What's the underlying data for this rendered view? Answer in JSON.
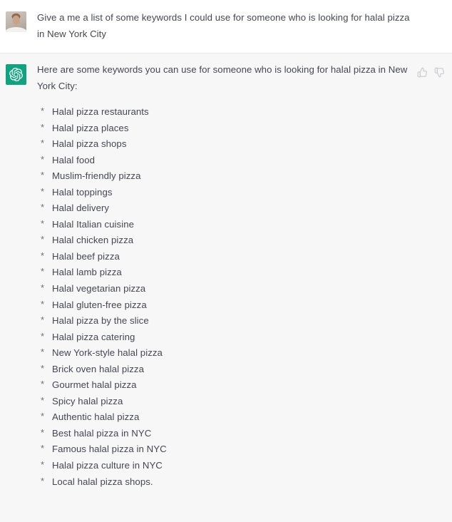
{
  "conversation": {
    "user_turn": {
      "avatar": "user-photo-avatar",
      "message": "Give a me a list of some keywords I could use for someone who is looking for halal pizza in New York City"
    },
    "assistant_turn": {
      "avatar": "openai-logo-avatar",
      "intro": "Here are some keywords you can use for someone who is looking for halal pizza in New York City:",
      "feedback": {
        "thumbs_up": "thumbs-up-icon",
        "thumbs_down": "thumbs-down-icon"
      },
      "bullet_glyph": "*",
      "keywords": [
        "Halal pizza restaurants",
        "Halal pizza places",
        "Halal pizza shops",
        "Halal food",
        "Muslim-friendly pizza",
        "Halal toppings",
        "Halal delivery",
        "Halal Italian cuisine",
        "Halal chicken pizza",
        "Halal beef pizza",
        "Halal lamb pizza",
        "Halal vegetarian pizza",
        "Halal gluten-free pizza",
        "Halal pizza by the slice",
        "Halal pizza catering",
        "New York-style halal pizza",
        "Brick oven halal pizza",
        "Gourmet halal pizza",
        "Spicy halal pizza",
        "Authentic halal pizza",
        "Best halal pizza in NYC",
        "Famous halal pizza in NYC",
        "Halal pizza culture in NYC",
        "Local halal pizza shops."
      ]
    }
  },
  "colors": {
    "assistant_avatar_green": "#10a37f",
    "assistant_background": "#f7f7f8",
    "user_background": "#ffffff",
    "text": "#454750",
    "divider": "#e7e7e8",
    "feedback_icon": "#c9cace"
  }
}
